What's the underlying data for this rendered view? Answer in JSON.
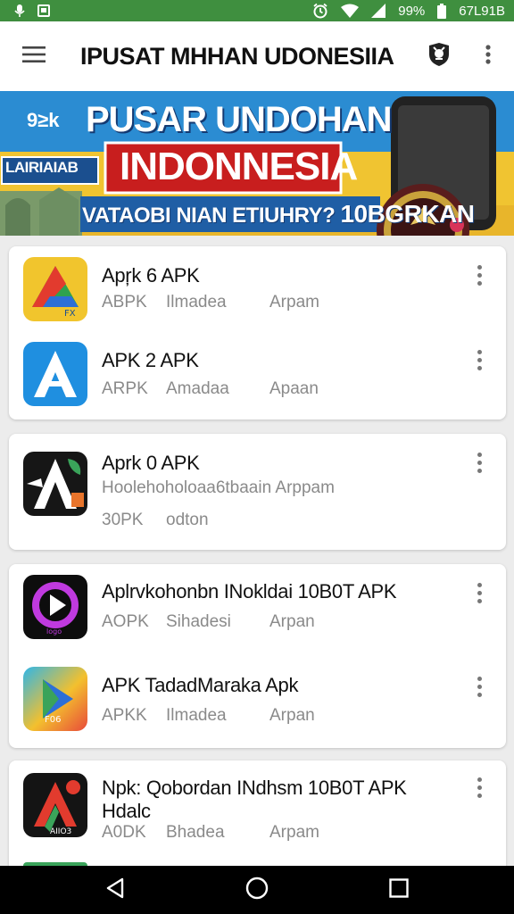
{
  "status_bar": {
    "battery_percent": "99%",
    "extra": "67L91B",
    "left_icons": [
      "mic-icon",
      "message-icon"
    ],
    "right_icons": [
      "alarm-icon",
      "wifi-icon",
      "signal-icon",
      "battery-icon"
    ]
  },
  "app_bar": {
    "title": "IPUSAT  MHHAN UDONESIIA",
    "menu_icon": "hamburger-menu-icon",
    "badge_icon": "emblem-badge-icon",
    "overflow_icon": "more-vert-icon"
  },
  "banner": {
    "tag": "9≥k",
    "line1": "PUSAR UNDOHAN",
    "side": "LAIRIAIAB",
    "line2": "INDONNESIA",
    "bottom": "VATAOBI NIAN ETIUHRY?",
    "bottom_strong": "10BGRKAN"
  },
  "cards": [
    {
      "rows": [
        {
          "name": "Apŗk 6 APK",
          "meta": [
            "ABPK",
            "Ilmadea",
            "Arpam"
          ],
          "icon": "green-drive-icon"
        },
        {
          "name": "APK 2 APK",
          "meta": [
            "ARPK",
            "Amadaa",
            "Apaan"
          ],
          "icon": "blue-a-icon"
        }
      ]
    },
    {
      "rows": [
        {
          "name": "Aprk 0 APK",
          "meta_line1": "Hoolehoholoaa6tbaain Arppam",
          "meta": [
            "30PK",
            "odton"
          ],
          "icon": "dark-a-icon"
        }
      ]
    },
    {
      "rows": [
        {
          "name": "Aplrvkohonbn INokldai 10B0T APK",
          "meta": [
            "AOPK",
            "Sihadesi",
            "Arpan"
          ],
          "icon": "purple-play-icon"
        },
        {
          "name": "APK  TadadMaraka Apk",
          "meta": [
            "APKK",
            "Ilmadea",
            "Arpan"
          ],
          "icon": "colorful-play-icon"
        }
      ]
    },
    {
      "rows": [
        {
          "name": "Npk: Qobordan INdhsm 10B0T APK",
          "name_line2": "Hdalc",
          "meta": [
            "A0DK",
            "Bhadea",
            "Arpam"
          ],
          "icon": "red-a-icon"
        }
      ]
    }
  ],
  "nav_bar": {
    "icons": [
      "back-icon",
      "home-icon",
      "recents-icon"
    ]
  },
  "colors": {
    "status_bar": "#3f8f3f",
    "app_bar": "#ffffff",
    "background": "#ececec",
    "meta_text": "#8a8a8a"
  }
}
